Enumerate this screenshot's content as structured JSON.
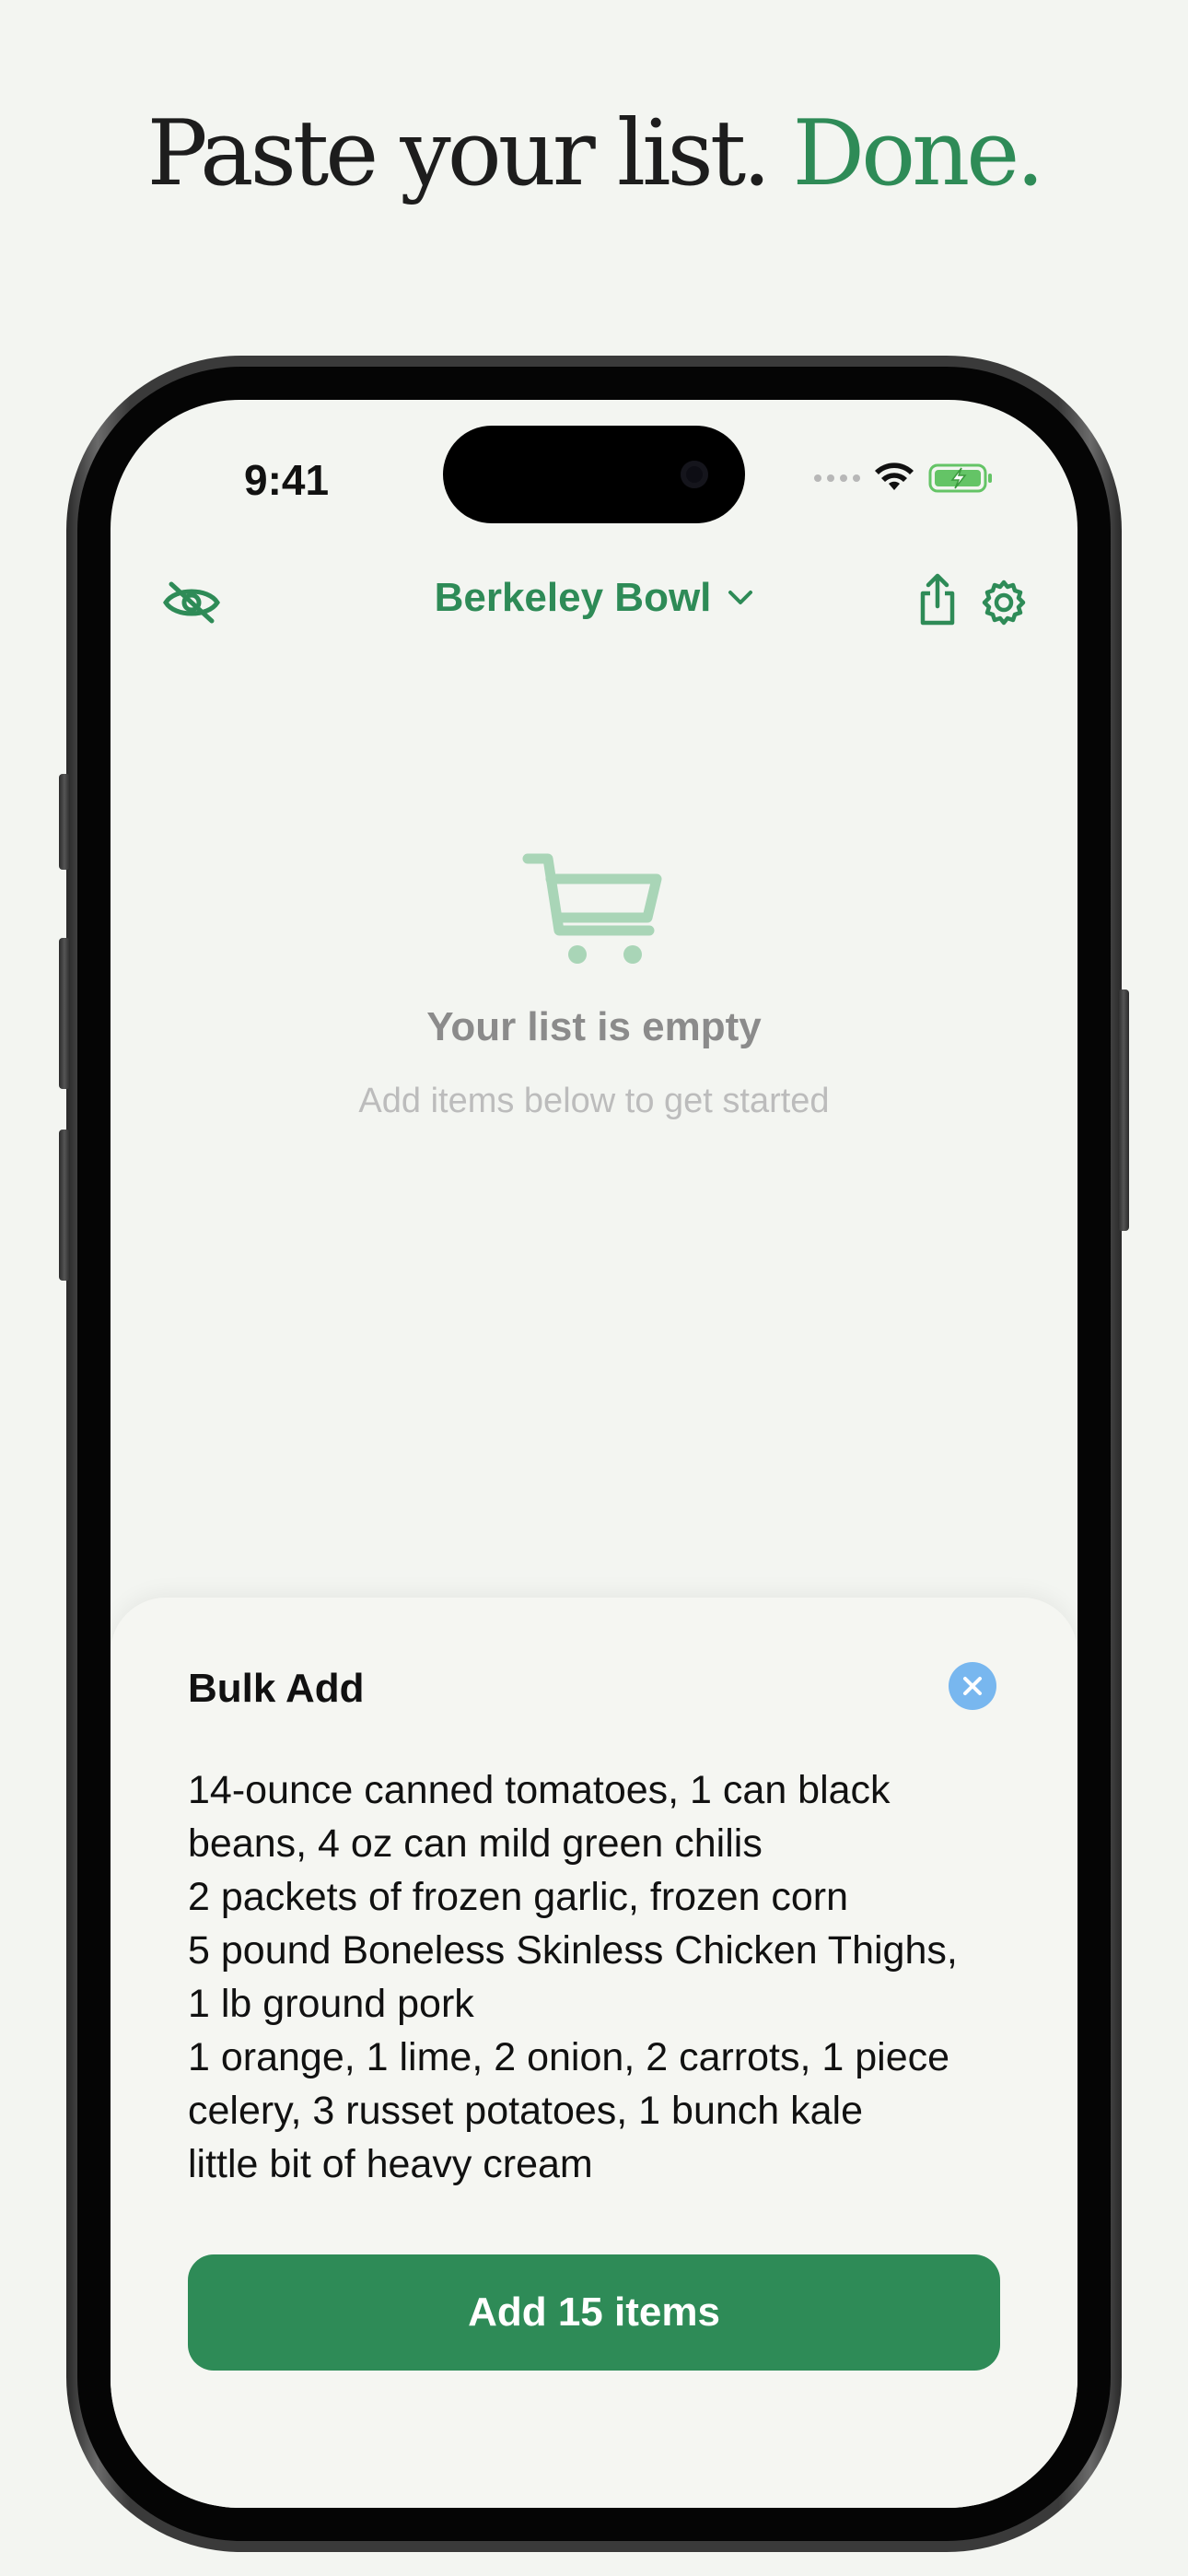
{
  "headline": {
    "text": "Paste your list.",
    "accent": "Done."
  },
  "status_bar": {
    "time": "9:41"
  },
  "nav": {
    "store_name": "Berkeley Bowl",
    "left_icon": "eye-slash-icon",
    "right_icons": [
      "share-icon",
      "gear-icon"
    ]
  },
  "empty_state": {
    "icon": "cart-icon",
    "title": "Your list is empty",
    "subtitle": "Add items below to get started"
  },
  "bulk_add": {
    "title": "Bulk Add",
    "close_icon": "close-icon",
    "text": "14-ounce canned tomatoes, 1 can black\nbeans, 4 oz can mild green chilis\n2 packets of frozen garlic, frozen corn\n5 pound Boneless Skinless Chicken Thighs,\n1 lb ground pork\n1 orange, 1 lime, 2 onion, 2 carrots, 1 piece\ncelery, 3 russet potatoes, 1 bunch kale\nlittle bit of heavy cream",
    "button_label": "Add 15 items"
  },
  "colors": {
    "accent": "#2e8b57",
    "background": "#f3f5f1",
    "close_button": "#78b7ef",
    "muted_text": "#8b8b8b"
  }
}
